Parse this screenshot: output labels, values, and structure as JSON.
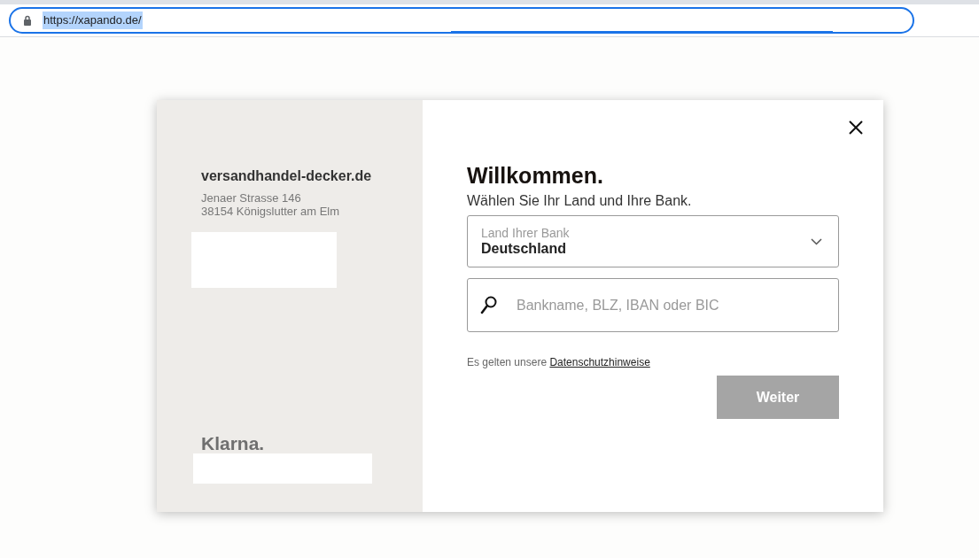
{
  "address_bar": {
    "url": "https://xapando.de/",
    "selected": true
  },
  "merchant": {
    "name": "versandhandel-decker.de",
    "address_lines": [
      "Jenaer Strasse 146",
      "38154 Königslutter am Elm"
    ]
  },
  "brand": {
    "logo_text": "Klarna."
  },
  "dialog": {
    "title": "Willkommen.",
    "subtitle": "Wählen Sie Ihr Land und Ihre Bank.",
    "country_select": {
      "label": "Land Ihrer Bank",
      "value": "Deutschland"
    },
    "bank_search": {
      "placeholder": "Bankname, BLZ, IBAN oder BIC"
    },
    "privacy_note": {
      "text": "Es gelten unsere",
      "link": "Datenschutzhinweise"
    },
    "continue_button": {
      "label": "Weiter",
      "disabled": true
    }
  }
}
